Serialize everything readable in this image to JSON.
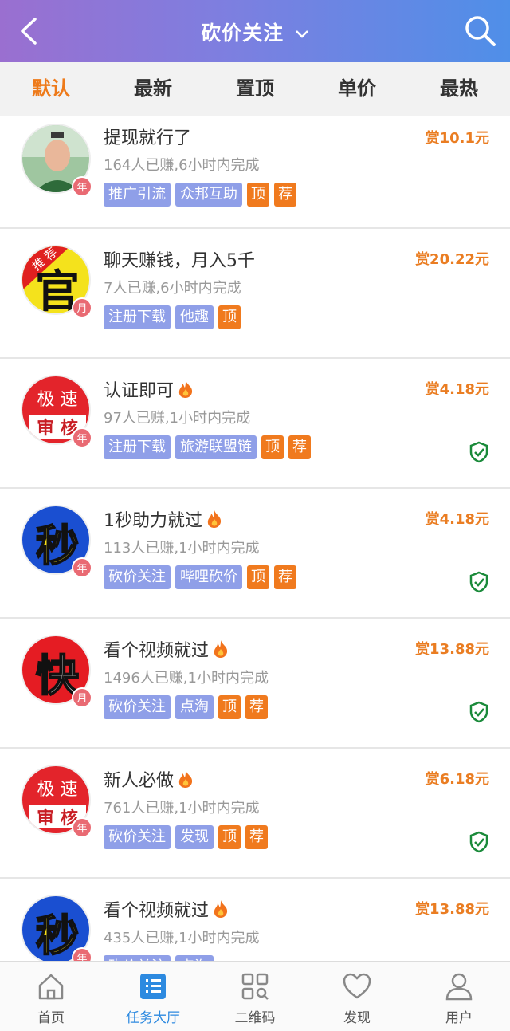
{
  "header": {
    "title": "砍价关注"
  },
  "filters": [
    {
      "label": "默认",
      "active": true
    },
    {
      "label": "最新"
    },
    {
      "label": "置顶"
    },
    {
      "label": "单价"
    },
    {
      "label": "最热"
    }
  ],
  "tasks": [
    {
      "title": "提现就行了",
      "meta": "164人已赚,6小时内完成",
      "reward": "赏10.1元",
      "badge": "年",
      "tags": [
        "推广引流",
        "众邦互助"
      ],
      "hot_tags": [
        "顶",
        "荐"
      ],
      "fire": false,
      "verified": false,
      "avatar": "photo"
    },
    {
      "title": "聊天赚钱，月入5千",
      "meta": "7人已赚,6小时内完成",
      "reward": "赏20.22元",
      "badge": "月",
      "tags": [
        "注册下载",
        "他趣"
      ],
      "hot_tags": [
        "顶"
      ],
      "fire": false,
      "verified": false,
      "avatar": "guan",
      "avatar_text": {
        "ribbon": "推 荐",
        "main": "官"
      }
    },
    {
      "title": "认证即可",
      "meta": "97人已赚,1小时内完成",
      "reward": "赏4.18元",
      "badge": "年",
      "tags": [
        "注册下载",
        "旅游联盟链"
      ],
      "hot_tags": [
        "顶",
        "荐"
      ],
      "fire": true,
      "verified": true,
      "avatar": "jisu",
      "avatar_text": {
        "top": "极 速",
        "bottom": "审 核"
      }
    },
    {
      "title": "1秒助力就过",
      "meta": "113人已赚,1小时内完成",
      "reward": "赏4.18元",
      "badge": "年",
      "tags": [
        "砍价关注",
        "哔哩砍价"
      ],
      "hot_tags": [
        "顶",
        "荐"
      ],
      "fire": true,
      "verified": true,
      "avatar": "miao",
      "avatar_text": {
        "main": "秒"
      }
    },
    {
      "title": "看个视频就过",
      "meta": "1496人已赚,1小时内完成",
      "reward": "赏13.88元",
      "badge": "月",
      "tags": [
        "砍价关注",
        "点淘"
      ],
      "hot_tags": [
        "顶",
        "荐"
      ],
      "fire": true,
      "verified": true,
      "avatar": "kuai",
      "avatar_text": {
        "main": "快"
      }
    },
    {
      "title": "新人必做",
      "meta": "761人已赚,1小时内完成",
      "reward": "赏6.18元",
      "badge": "年",
      "tags": [
        "砍价关注",
        "发现"
      ],
      "hot_tags": [
        "顶",
        "荐"
      ],
      "fire": true,
      "verified": true,
      "avatar": "jisu",
      "avatar_text": {
        "top": "极 速",
        "bottom": "审 核"
      }
    },
    {
      "title": "看个视频就过",
      "meta": "435人已赚,1小时内完成",
      "reward": "赏13.88元",
      "badge": "年",
      "tags": [
        "砍价关注",
        "点淘"
      ],
      "hot_tags": [],
      "fire": true,
      "verified": false,
      "avatar": "miao",
      "avatar_text": {
        "main": "秒"
      }
    }
  ],
  "tabbar": [
    {
      "label": "首页",
      "icon": "home-icon"
    },
    {
      "label": "任务大厅",
      "icon": "task-list-icon",
      "active": true
    },
    {
      "label": "二维码",
      "icon": "qrcode-icon"
    },
    {
      "label": "发现",
      "icon": "heart-icon"
    },
    {
      "label": "用户",
      "icon": "user-icon"
    }
  ],
  "colors": {
    "accent": "#ee7a1a",
    "tag": "#8f9fe8",
    "reward": "#ea7d22",
    "verified": "#1a8a3a",
    "tab_active": "#2d8ae0"
  }
}
